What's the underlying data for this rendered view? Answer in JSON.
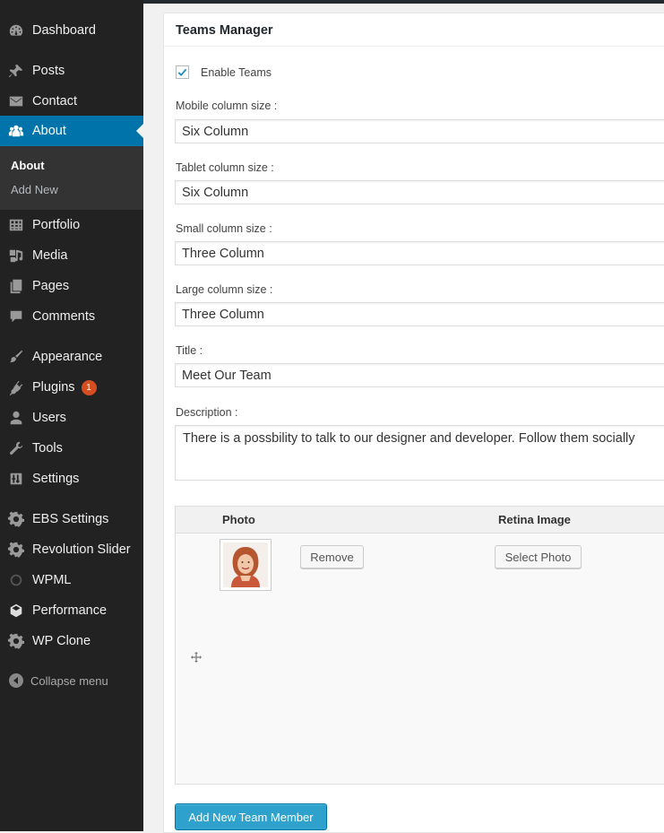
{
  "sidebar": {
    "items": [
      {
        "label": "Dashboard",
        "icon": "dashboard-icon"
      },
      {
        "label": "Posts",
        "icon": "pin-icon"
      },
      {
        "label": "Contact",
        "icon": "mail-icon"
      },
      {
        "label": "About",
        "icon": "people-icon"
      },
      {
        "label": "Portfolio",
        "icon": "grid-icon"
      },
      {
        "label": "Media",
        "icon": "media-icon"
      },
      {
        "label": "Pages",
        "icon": "pages-icon"
      },
      {
        "label": "Comments",
        "icon": "comment-icon"
      },
      {
        "label": "Appearance",
        "icon": "brush-icon"
      },
      {
        "label": "Plugins",
        "icon": "plugin-icon",
        "badge": "1"
      },
      {
        "label": "Users",
        "icon": "user-icon"
      },
      {
        "label": "Tools",
        "icon": "wrench-icon"
      },
      {
        "label": "Settings",
        "icon": "settings-icon"
      },
      {
        "label": "EBS Settings",
        "icon": "gear-icon"
      },
      {
        "label": "Revolution Slider",
        "icon": "gear-icon"
      },
      {
        "label": "WPML",
        "icon": "wpml-icon"
      },
      {
        "label": "Performance",
        "icon": "cube-icon"
      },
      {
        "label": "WP Clone",
        "icon": "gear-icon"
      }
    ],
    "submenu": [
      {
        "label": "About"
      },
      {
        "label": "Add New"
      }
    ],
    "collapse_label": "Collapse menu",
    "active_color": "#0073aa",
    "badge_color": "#d54e21"
  },
  "panel": {
    "title": "Teams Manager",
    "enable_label": "Enable Teams",
    "enable_checked": true,
    "fields": {
      "mobile_label": "Mobile column size :",
      "mobile_value": "Six Column",
      "tablet_label": "Tablet column size :",
      "tablet_value": "Six Column",
      "small_label": "Small column size :",
      "small_value": "Three Column",
      "large_label": "Large column size :",
      "large_value": "Three Column",
      "title_label": "Title :",
      "title_value": "Meet Our Team",
      "description_label": "Description :",
      "description_value": "There is a possbility to talk to our designer and developer. Follow them socially"
    },
    "members": {
      "col_photo": "Photo",
      "col_retina": "Retina Image",
      "remove_label": "Remove",
      "select_photo_label": "Select Photo"
    },
    "add_member_label": "Add New Team Member",
    "primary_color": "#2ea2cc"
  }
}
